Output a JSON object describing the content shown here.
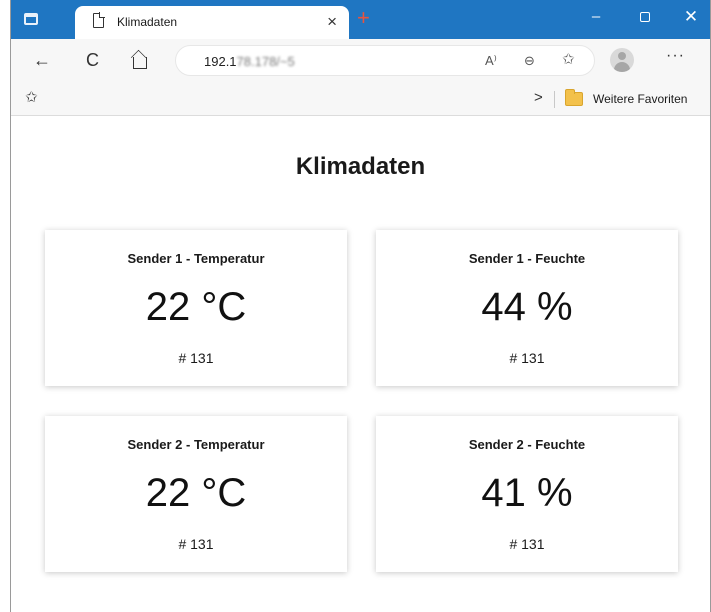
{
  "browser": {
    "tab": {
      "title": "Klimadaten",
      "close": "×"
    },
    "new_tab": "+",
    "window_buttons": {
      "minimize": "–",
      "close": "✕"
    },
    "nav": {
      "back": "←",
      "reload": "C",
      "read_aloud": "A⁾",
      "zoom": "⊖",
      "favorite": "✩",
      "more": "···"
    },
    "address": {
      "url_visible": "192.1",
      "url_obscured": "78.178/~5"
    },
    "favorites_bar": {
      "star": "✩",
      "chevron": ">",
      "folder_label": "Weitere Favoriten"
    },
    "accent_color": "#1f76c2"
  },
  "page": {
    "title": "Klimadaten",
    "cards": [
      {
        "label": "Sender 1 - Temperatur",
        "value": "22 °C",
        "count": "# 131"
      },
      {
        "label": "Sender 1 - Feuchte",
        "value": "44 %",
        "count": "# 131"
      },
      {
        "label": "Sender 2 - Temperatur",
        "value": "22 °C",
        "count": "# 131"
      },
      {
        "label": "Sender 2 - Feuchte",
        "value": "41 %",
        "count": "# 131"
      }
    ]
  }
}
